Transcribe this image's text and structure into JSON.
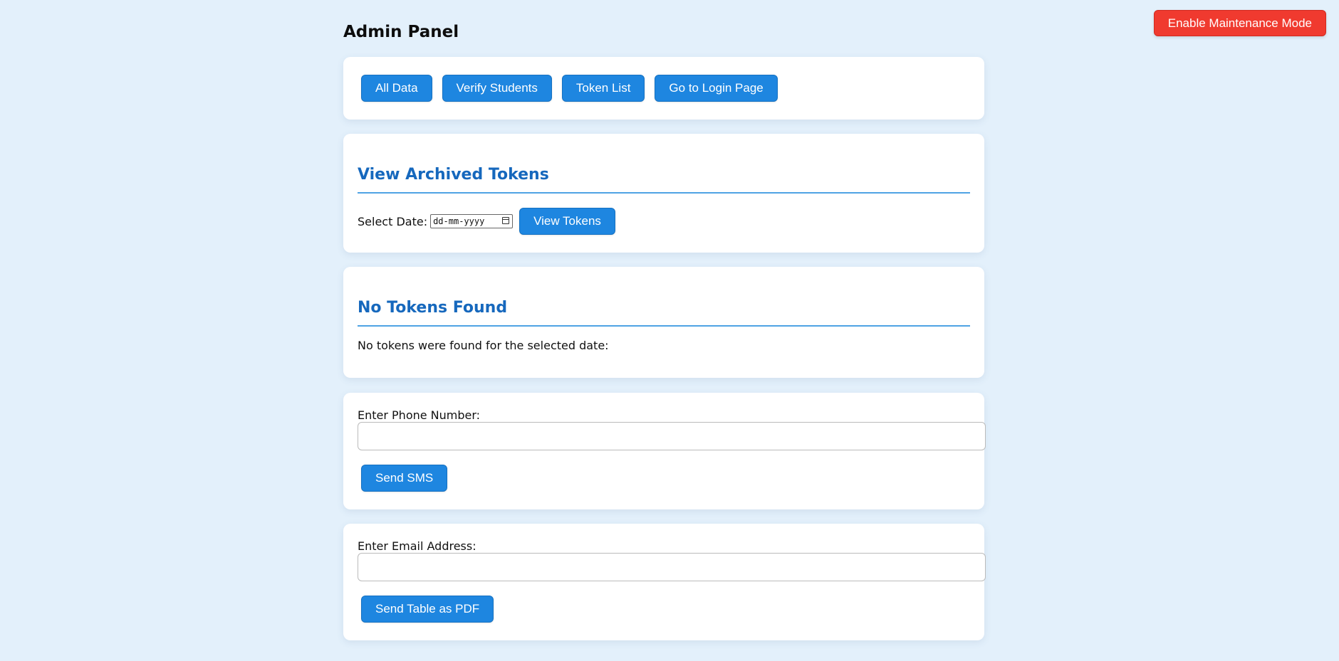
{
  "header": {
    "title": "Admin Panel",
    "maintenance_label": "Enable Maintenance Mode"
  },
  "nav": {
    "buttons": [
      {
        "label": "All Data"
      },
      {
        "label": "Verify Students"
      },
      {
        "label": "Token List"
      },
      {
        "label": "Go to Login Page"
      }
    ]
  },
  "archived": {
    "heading": "View Archived Tokens",
    "date_label": "Select Date:",
    "date_placeholder": "dd-mm-yyyy",
    "view_button": "View Tokens"
  },
  "no_tokens": {
    "heading": "No Tokens Found",
    "message": "No tokens were found for the selected date:"
  },
  "sms": {
    "label": "Enter Phone Number:",
    "value": "",
    "button": "Send SMS"
  },
  "email": {
    "label": "Enter Email Address:",
    "value": "",
    "button": "Send Table as PDF"
  },
  "colors": {
    "background": "#e3f0fb",
    "primary_button": "#1e86e0",
    "danger_button": "#f03a2f",
    "heading": "#1668bd"
  }
}
